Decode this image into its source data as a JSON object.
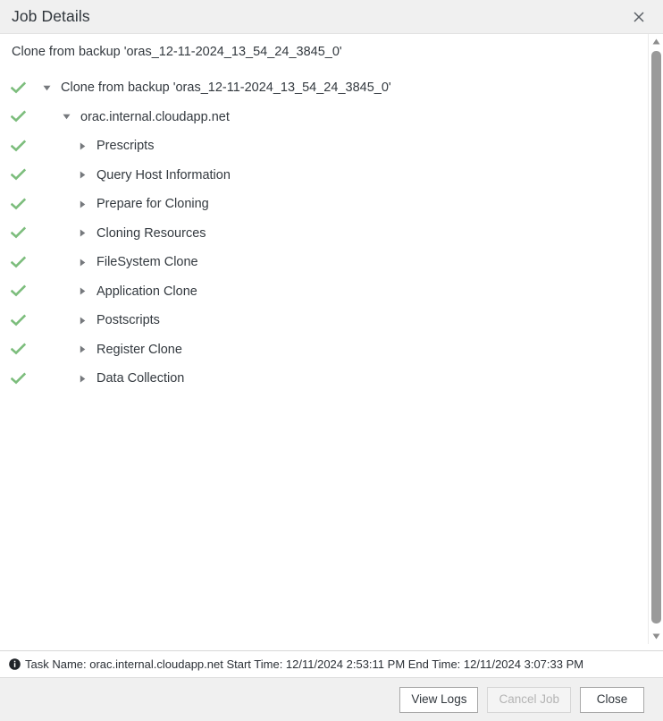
{
  "window": {
    "title": "Job Details",
    "close_icon": "close-icon"
  },
  "subtitle": "Clone from backup 'oras_12-11-2024_13_54_24_3845_0'",
  "tree": {
    "nodes": [
      {
        "label": "Clone from backup 'oras_12-11-2024_13_54_24_3845_0'",
        "level": 0,
        "expanded": true,
        "status": "success"
      },
      {
        "label": "orac.internal.cloudapp.net",
        "level": 1,
        "expanded": true,
        "status": "success"
      },
      {
        "label": "Prescripts",
        "level": 2,
        "expanded": false,
        "status": "success"
      },
      {
        "label": "Query Host Information",
        "level": 2,
        "expanded": false,
        "status": "success"
      },
      {
        "label": "Prepare for Cloning",
        "level": 2,
        "expanded": false,
        "status": "success"
      },
      {
        "label": "Cloning Resources",
        "level": 2,
        "expanded": false,
        "status": "success"
      },
      {
        "label": "FileSystem Clone",
        "level": 2,
        "expanded": false,
        "status": "success"
      },
      {
        "label": "Application Clone",
        "level": 2,
        "expanded": false,
        "status": "success"
      },
      {
        "label": "Postscripts",
        "level": 2,
        "expanded": false,
        "status": "success"
      },
      {
        "label": "Register Clone",
        "level": 2,
        "expanded": false,
        "status": "success"
      },
      {
        "label": "Data Collection",
        "level": 2,
        "expanded": false,
        "status": "success"
      }
    ]
  },
  "statusbar": {
    "icon": "info-icon",
    "text": "Task Name: orac.internal.cloudapp.net Start Time: 12/11/2024 2:53:11 PM End Time: 12/11/2024 3:07:33 PM"
  },
  "footer": {
    "view_logs_label": "View Logs",
    "cancel_job_label": "Cancel Job",
    "close_label": "Close",
    "cancel_job_disabled": true
  },
  "colors": {
    "success_check": "#7cbd7c",
    "titlebar_bg": "#f0f0f0",
    "footer_bg": "#f0f0f0",
    "text": "#33393f",
    "scrollbar_thumb": "#9a9a9a"
  }
}
